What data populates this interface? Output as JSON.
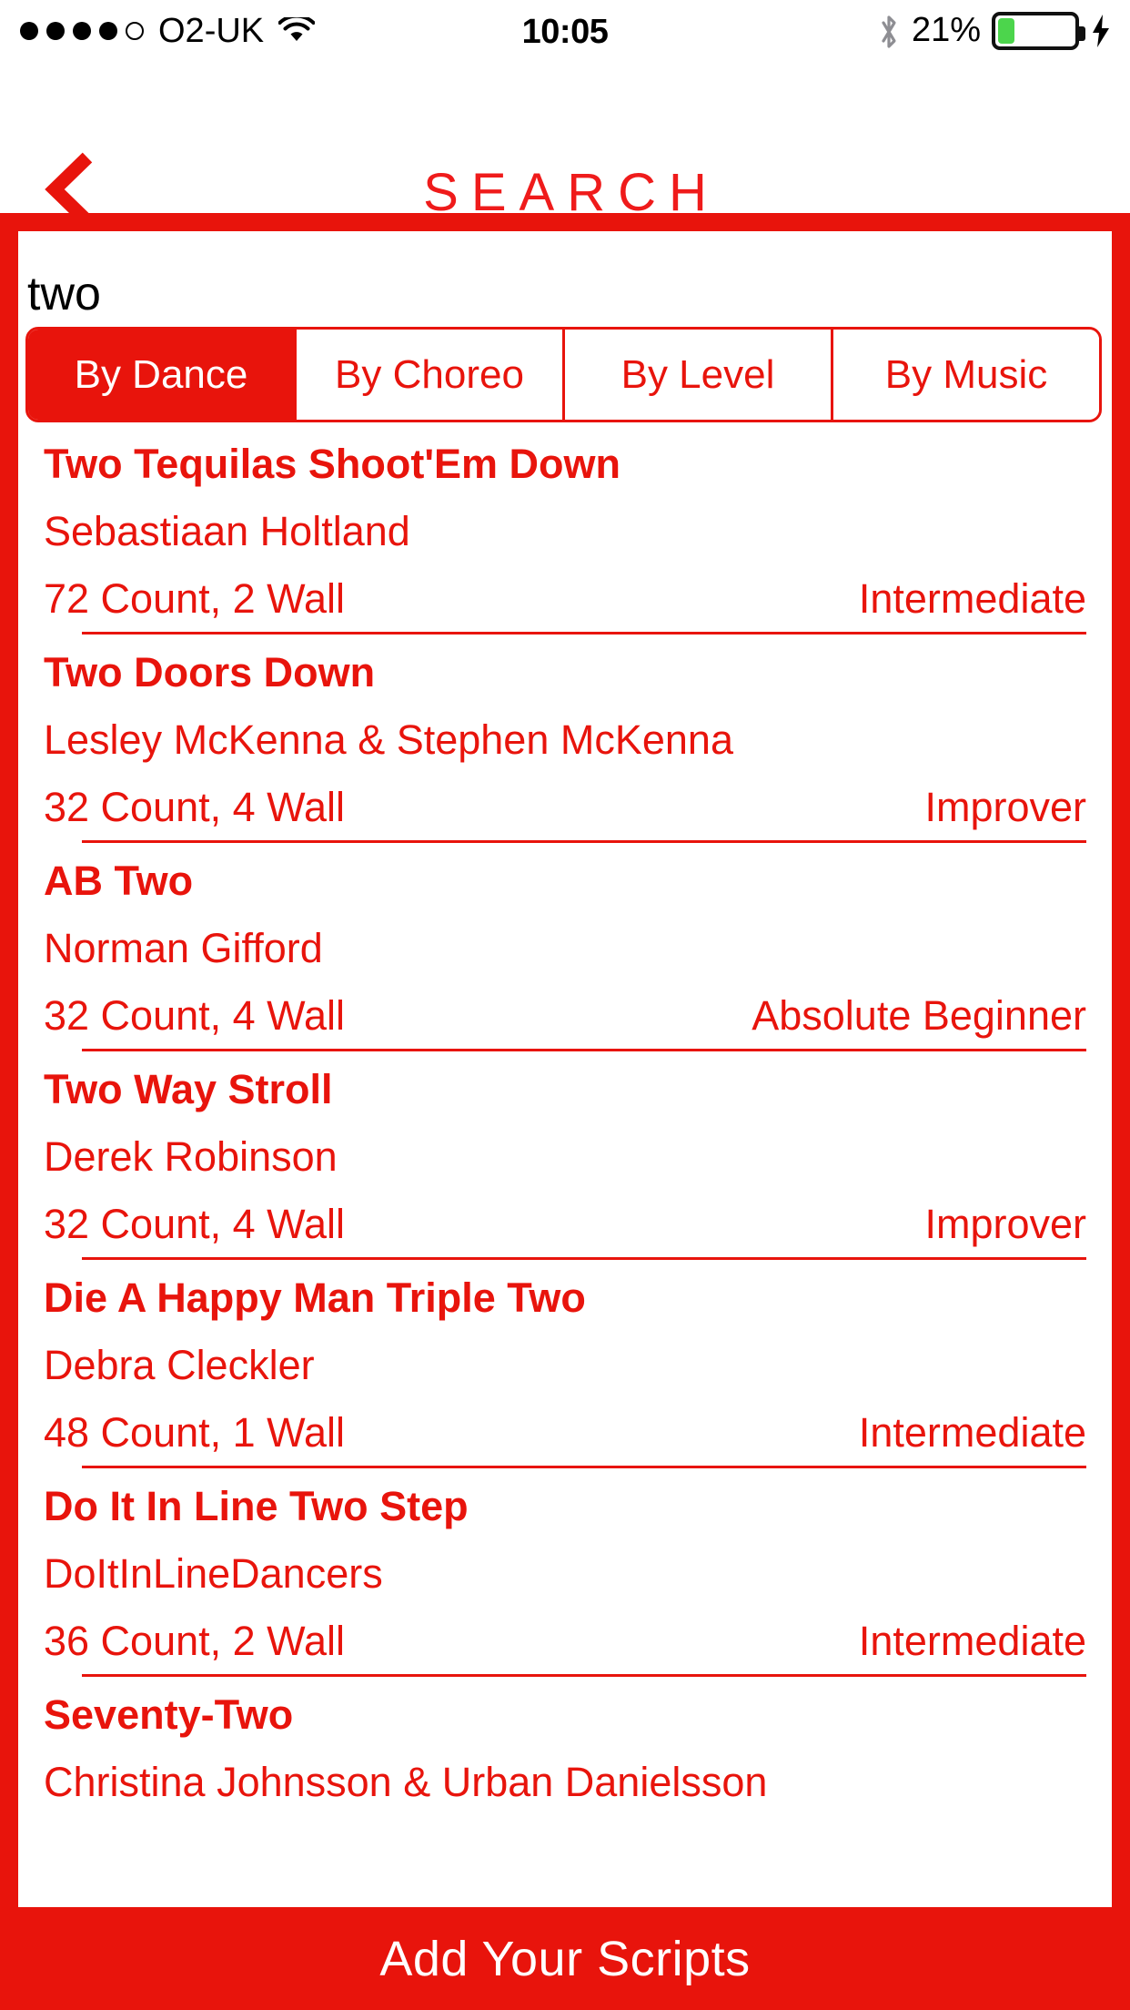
{
  "status_bar": {
    "signal_dots_filled": 4,
    "signal_dots_total": 5,
    "carrier": "O2-UK",
    "wifi_icon": "wifi-icon",
    "time": "10:05",
    "bluetooth_icon": "bluetooth-icon",
    "battery_percent": "21%",
    "battery_level": 21,
    "battery_fill_color": "#4cd54c",
    "charging_icon": "lightning-bolt-icon"
  },
  "header": {
    "back_icon": "chevron-left-icon",
    "title": "SEARCH",
    "accent_color": "#e8140c"
  },
  "search": {
    "value": "two",
    "placeholder": "Search"
  },
  "segments": [
    {
      "label": "By Dance",
      "selected": true
    },
    {
      "label": "By Choreo",
      "selected": false
    },
    {
      "label": "By Level",
      "selected": false
    },
    {
      "label": "By Music",
      "selected": false
    }
  ],
  "results": [
    {
      "title": "Two Tequilas Shoot'Em Down",
      "choreographer": "Sebastiaan Holtland",
      "count_wall": "72 Count, 2 Wall",
      "level": "Intermediate"
    },
    {
      "title": "Two Doors Down",
      "choreographer": "Lesley McKenna & Stephen McKenna",
      "count_wall": "32 Count, 4 Wall",
      "level": "Improver"
    },
    {
      "title": "AB Two",
      "choreographer": "Norman Gifford",
      "count_wall": "32 Count, 4 Wall",
      "level": "Absolute Beginner"
    },
    {
      "title": "Two Way Stroll",
      "choreographer": "Derek Robinson",
      "count_wall": "32 Count, 4 Wall",
      "level": "Improver"
    },
    {
      "title": "Die A Happy Man Triple Two",
      "choreographer": "Debra Cleckler",
      "count_wall": "48 Count, 1 Wall",
      "level": "Intermediate"
    },
    {
      "title": "Do It In Line Two Step",
      "choreographer": "DoItInLineDancers",
      "count_wall": "36 Count, 2 Wall",
      "level": "Intermediate"
    },
    {
      "title": "Seventy-Two",
      "choreographer": "Christina Johnsson & Urban Danielsson",
      "count_wall": "",
      "level": ""
    }
  ],
  "bottom_bar": {
    "label": "Add Your Scripts"
  }
}
